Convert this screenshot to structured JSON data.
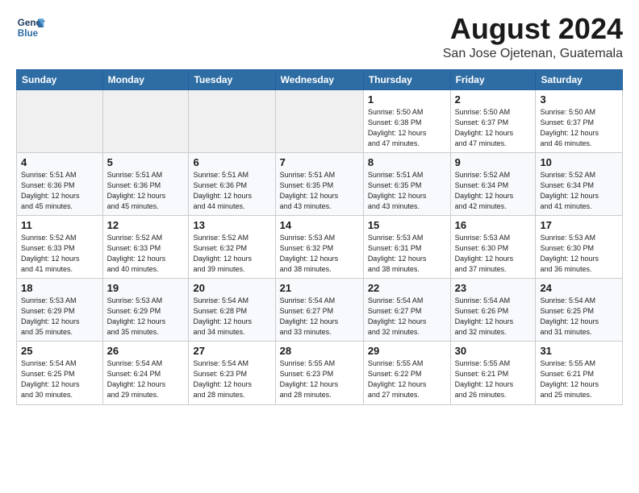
{
  "header": {
    "logo_line1": "General",
    "logo_line2": "Blue",
    "month_year": "August 2024",
    "location": "San Jose Ojetenan, Guatemala"
  },
  "weekdays": [
    "Sunday",
    "Monday",
    "Tuesday",
    "Wednesday",
    "Thursday",
    "Friday",
    "Saturday"
  ],
  "weeks": [
    [
      {
        "day": "",
        "info": ""
      },
      {
        "day": "",
        "info": ""
      },
      {
        "day": "",
        "info": ""
      },
      {
        "day": "",
        "info": ""
      },
      {
        "day": "1",
        "info": "Sunrise: 5:50 AM\nSunset: 6:38 PM\nDaylight: 12 hours\nand 47 minutes."
      },
      {
        "day": "2",
        "info": "Sunrise: 5:50 AM\nSunset: 6:37 PM\nDaylight: 12 hours\nand 47 minutes."
      },
      {
        "day": "3",
        "info": "Sunrise: 5:50 AM\nSunset: 6:37 PM\nDaylight: 12 hours\nand 46 minutes."
      }
    ],
    [
      {
        "day": "4",
        "info": "Sunrise: 5:51 AM\nSunset: 6:36 PM\nDaylight: 12 hours\nand 45 minutes."
      },
      {
        "day": "5",
        "info": "Sunrise: 5:51 AM\nSunset: 6:36 PM\nDaylight: 12 hours\nand 45 minutes."
      },
      {
        "day": "6",
        "info": "Sunrise: 5:51 AM\nSunset: 6:36 PM\nDaylight: 12 hours\nand 44 minutes."
      },
      {
        "day": "7",
        "info": "Sunrise: 5:51 AM\nSunset: 6:35 PM\nDaylight: 12 hours\nand 43 minutes."
      },
      {
        "day": "8",
        "info": "Sunrise: 5:51 AM\nSunset: 6:35 PM\nDaylight: 12 hours\nand 43 minutes."
      },
      {
        "day": "9",
        "info": "Sunrise: 5:52 AM\nSunset: 6:34 PM\nDaylight: 12 hours\nand 42 minutes."
      },
      {
        "day": "10",
        "info": "Sunrise: 5:52 AM\nSunset: 6:34 PM\nDaylight: 12 hours\nand 41 minutes."
      }
    ],
    [
      {
        "day": "11",
        "info": "Sunrise: 5:52 AM\nSunset: 6:33 PM\nDaylight: 12 hours\nand 41 minutes."
      },
      {
        "day": "12",
        "info": "Sunrise: 5:52 AM\nSunset: 6:33 PM\nDaylight: 12 hours\nand 40 minutes."
      },
      {
        "day": "13",
        "info": "Sunrise: 5:52 AM\nSunset: 6:32 PM\nDaylight: 12 hours\nand 39 minutes."
      },
      {
        "day": "14",
        "info": "Sunrise: 5:53 AM\nSunset: 6:32 PM\nDaylight: 12 hours\nand 38 minutes."
      },
      {
        "day": "15",
        "info": "Sunrise: 5:53 AM\nSunset: 6:31 PM\nDaylight: 12 hours\nand 38 minutes."
      },
      {
        "day": "16",
        "info": "Sunrise: 5:53 AM\nSunset: 6:30 PM\nDaylight: 12 hours\nand 37 minutes."
      },
      {
        "day": "17",
        "info": "Sunrise: 5:53 AM\nSunset: 6:30 PM\nDaylight: 12 hours\nand 36 minutes."
      }
    ],
    [
      {
        "day": "18",
        "info": "Sunrise: 5:53 AM\nSunset: 6:29 PM\nDaylight: 12 hours\nand 35 minutes."
      },
      {
        "day": "19",
        "info": "Sunrise: 5:53 AM\nSunset: 6:29 PM\nDaylight: 12 hours\nand 35 minutes."
      },
      {
        "day": "20",
        "info": "Sunrise: 5:54 AM\nSunset: 6:28 PM\nDaylight: 12 hours\nand 34 minutes."
      },
      {
        "day": "21",
        "info": "Sunrise: 5:54 AM\nSunset: 6:27 PM\nDaylight: 12 hours\nand 33 minutes."
      },
      {
        "day": "22",
        "info": "Sunrise: 5:54 AM\nSunset: 6:27 PM\nDaylight: 12 hours\nand 32 minutes."
      },
      {
        "day": "23",
        "info": "Sunrise: 5:54 AM\nSunset: 6:26 PM\nDaylight: 12 hours\nand 32 minutes."
      },
      {
        "day": "24",
        "info": "Sunrise: 5:54 AM\nSunset: 6:25 PM\nDaylight: 12 hours\nand 31 minutes."
      }
    ],
    [
      {
        "day": "25",
        "info": "Sunrise: 5:54 AM\nSunset: 6:25 PM\nDaylight: 12 hours\nand 30 minutes."
      },
      {
        "day": "26",
        "info": "Sunrise: 5:54 AM\nSunset: 6:24 PM\nDaylight: 12 hours\nand 29 minutes."
      },
      {
        "day": "27",
        "info": "Sunrise: 5:54 AM\nSunset: 6:23 PM\nDaylight: 12 hours\nand 28 minutes."
      },
      {
        "day": "28",
        "info": "Sunrise: 5:55 AM\nSunset: 6:23 PM\nDaylight: 12 hours\nand 28 minutes."
      },
      {
        "day": "29",
        "info": "Sunrise: 5:55 AM\nSunset: 6:22 PM\nDaylight: 12 hours\nand 27 minutes."
      },
      {
        "day": "30",
        "info": "Sunrise: 5:55 AM\nSunset: 6:21 PM\nDaylight: 12 hours\nand 26 minutes."
      },
      {
        "day": "31",
        "info": "Sunrise: 5:55 AM\nSunset: 6:21 PM\nDaylight: 12 hours\nand 25 minutes."
      }
    ]
  ]
}
